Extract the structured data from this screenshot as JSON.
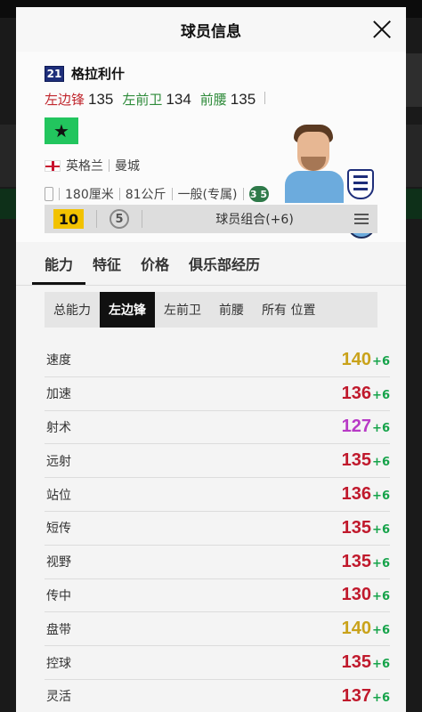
{
  "modal": {
    "title": "球员信息"
  },
  "player": {
    "season_badge": "21",
    "name": "格拉利什",
    "positions": [
      {
        "label": "左边锋",
        "value": "135",
        "color": "#c0262d"
      },
      {
        "label": "左前卫",
        "value": "134",
        "color": "#2e8b3a"
      },
      {
        "label": "前腰",
        "value": "135",
        "color": "#2e8b3a"
      }
    ],
    "nation": "英格兰",
    "club": "曼城",
    "height": "180厘米",
    "weight": "81公斤",
    "body_type": "一般(专属)",
    "foot": "3 5"
  },
  "chem_bar": {
    "grade": "10",
    "level": "5",
    "label": "球员组合(+6)"
  },
  "tabs": [
    "能力",
    "特征",
    "价格",
    "俱乐部经历"
  ],
  "subtabs": [
    "总能力",
    "左边锋",
    "左前卫",
    "前腰",
    "所有 位置"
  ],
  "stats": [
    {
      "name": "速度",
      "value": "140",
      "bonus": "+6",
      "color": "#c9a21a"
    },
    {
      "name": "加速",
      "value": "136",
      "bonus": "+6",
      "color": "#c0192c"
    },
    {
      "name": "射术",
      "value": "127",
      "bonus": "+6",
      "color": "#b83ac6"
    },
    {
      "name": "远射",
      "value": "135",
      "bonus": "+6",
      "color": "#c0192c"
    },
    {
      "name": "站位",
      "value": "136",
      "bonus": "+6",
      "color": "#c0192c"
    },
    {
      "name": "短传",
      "value": "135",
      "bonus": "+6",
      "color": "#c0192c"
    },
    {
      "name": "视野",
      "value": "135",
      "bonus": "+6",
      "color": "#c0192c"
    },
    {
      "name": "传中",
      "value": "130",
      "bonus": "+6",
      "color": "#c0192c"
    },
    {
      "name": "盘带",
      "value": "140",
      "bonus": "+6",
      "color": "#c9a21a"
    },
    {
      "name": "控球",
      "value": "135",
      "bonus": "+6",
      "color": "#c0192c"
    },
    {
      "name": "灵活",
      "value": "137",
      "bonus": "+6",
      "color": "#c0192c"
    }
  ]
}
